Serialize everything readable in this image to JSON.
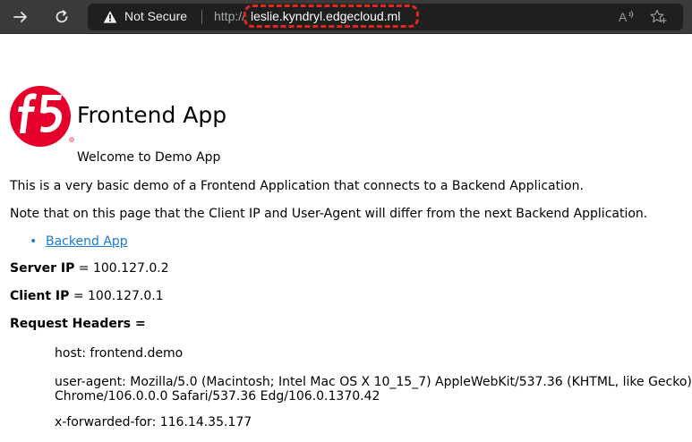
{
  "browser": {
    "security_label": "Not Secure",
    "url_prefix": "http://",
    "url_host": "leslie.kyndryl.edgecloud.ml",
    "annotation_color": "#e0261e"
  },
  "page": {
    "app_title": "Frontend App",
    "welcome": "Welcome to Demo App",
    "description": "This is a very basic demo of a Frontend Application that connects to a Backend Application.",
    "note": "Note that on this page that the Client IP and User-Agent will differ from the next Backend Application.",
    "backend_link": "Backend App",
    "server_ip_label": "Server IP",
    "server_ip_value": " = 100.127.0.2",
    "client_ip_label": "Client IP",
    "client_ip_value": " = 100.127.0.1",
    "request_headers_label": "Request Headers =",
    "headers": {
      "host": "host: frontend.demo",
      "user_agent_line1": "user-agent: Mozilla/5.0 (Macintosh; Intel Mac OS X 10_15_7) AppleWebKit/537.36 (KHTML, like Gecko)",
      "user_agent_line2": "Chrome/106.0.0.0 Safari/537.36 Edg/106.0.1370.42",
      "x_forwarded_for": "x-forwarded-for: 116.14.35.177"
    }
  },
  "icons": {
    "forward": "arrow-right-icon",
    "refresh": "refresh-icon",
    "warning": "warning-triangle-icon",
    "read_aloud": "read-aloud-icon",
    "favorites": "add-favorite-icon",
    "logo": "f5-logo"
  },
  "logo_color": "#e4002b"
}
